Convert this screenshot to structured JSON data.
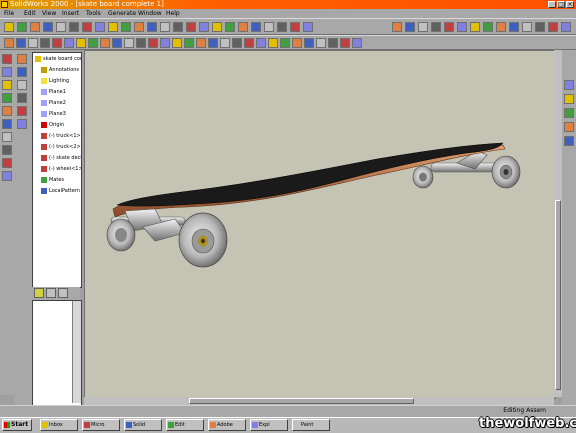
{
  "window": {
    "title": "SolidWorks 2000 - [skate board complete 1]"
  },
  "menu": [
    {
      "label": "File"
    },
    {
      "label": "Edit"
    },
    {
      "label": "View"
    },
    {
      "label": "Insert"
    },
    {
      "label": "Tools"
    },
    {
      "label": "Generate"
    },
    {
      "label": "Window"
    },
    {
      "label": "Help"
    }
  ],
  "tree": {
    "nodes": [
      {
        "label": "skate board complete",
        "icon": "assembly-icon"
      },
      {
        "label": "Annotations",
        "icon": "annotation-icon"
      },
      {
        "label": "Lighting",
        "icon": "lighting-icon"
      },
      {
        "label": "Plane1",
        "icon": "plane-icon"
      },
      {
        "label": "Plane2",
        "icon": "plane-icon"
      },
      {
        "label": "Plane3",
        "icon": "plane-icon"
      },
      {
        "label": "Origin",
        "icon": "origin-icon"
      },
      {
        "label": "(-) truck<1>",
        "icon": "part-icon"
      },
      {
        "label": "(-) truck<2>",
        "icon": "part-icon"
      },
      {
        "label": "(-) skate deck<1>",
        "icon": "part-icon"
      },
      {
        "label": "(-) wheel<1>",
        "icon": "part-icon"
      },
      {
        "label": "Mates",
        "icon": "mates-icon"
      },
      {
        "label": "LocalPattern",
        "icon": "pattern-icon"
      }
    ]
  },
  "status": {
    "text": "Editing Assem"
  },
  "taskbar": {
    "start_label": "Start",
    "tasks": [
      {
        "label": "Inbox"
      },
      {
        "label": "Micro"
      },
      {
        "label": "Solid"
      },
      {
        "label": "Edit"
      },
      {
        "label": "Adobe"
      },
      {
        "label": "Expl"
      },
      {
        "label": "Paint"
      }
    ],
    "clock": ""
  },
  "watermark": {
    "text": "thewolfweb.com"
  },
  "colors": {
    "title_start": "#d8a000",
    "title_end": "#ff5000",
    "viewport_bg": "#c4c3b4"
  }
}
